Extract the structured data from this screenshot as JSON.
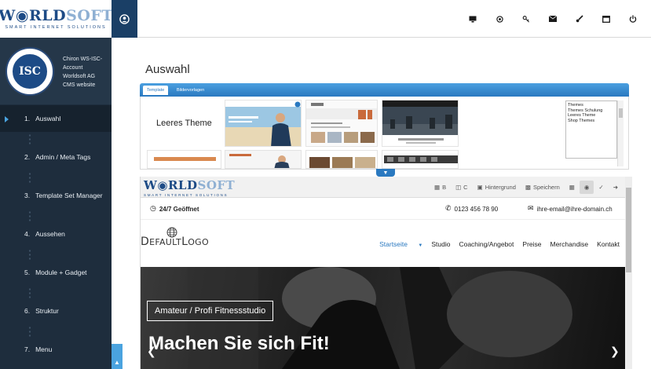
{
  "brand": {
    "logo_word_a": "W",
    "logo_word_b": "RLD",
    "logo_word_c": "SOFT",
    "logo_tagline": "SMART INTERNET SOLUTIONS",
    "accent": "#2a79c0",
    "sidebar_bg": "#1e2d3d"
  },
  "topbar": {
    "icons": [
      "monitor-icon",
      "target-icon",
      "key-icon",
      "mail-icon",
      "brush-icon",
      "window-icon",
      "power-icon"
    ]
  },
  "account": {
    "seal_text": "ISC",
    "line1": "Chiron WS-ISC-",
    "line2": "Account",
    "line3": "Worldsoft AG",
    "line4": "CMS website"
  },
  "nav": [
    {
      "num": "1.",
      "label": "Auswahl"
    },
    {
      "num": "2.",
      "label": "Admin / Meta Tags"
    },
    {
      "num": "3.",
      "label": "Template Set Manager"
    },
    {
      "num": "4.",
      "label": "Aussehen"
    },
    {
      "num": "5.",
      "label": "Module + Gadget"
    },
    {
      "num": "6.",
      "label": "Struktur"
    },
    {
      "num": "7.",
      "label": "Menu"
    }
  ],
  "main": {
    "title": "Auswahl",
    "tabs": [
      "Template",
      "Bildervorlagen"
    ],
    "leeres_theme": "Leeres Theme",
    "theme_list": [
      "Themes",
      "Themes Schulung",
      "Leeres Theme",
      "Shop Themes"
    ]
  },
  "preview": {
    "tools": [
      {
        "icon": "grid-icon",
        "label": "B"
      },
      {
        "icon": "columns-icon",
        "label": "C"
      },
      {
        "icon": "image-icon",
        "label": "Hintergrund"
      },
      {
        "icon": "save-icon",
        "label": "Speichern"
      }
    ],
    "hours": "24/7 Geöffnet",
    "phone": "0123 456 78 90",
    "email": "ihre-email@ihre-domain.ch",
    "logo_a": "D",
    "logo_b": "EFAULT",
    "logo_c": "L",
    "logo_d": "OGO",
    "menu": [
      "Startseite",
      "Studio",
      "Coaching/Angebot",
      "Preise",
      "Merchandise",
      "Kontakt"
    ],
    "hero_badge": "Amateur / Profi Fitnessstudio",
    "hero_title": "Machen Sie sich Fit!"
  }
}
